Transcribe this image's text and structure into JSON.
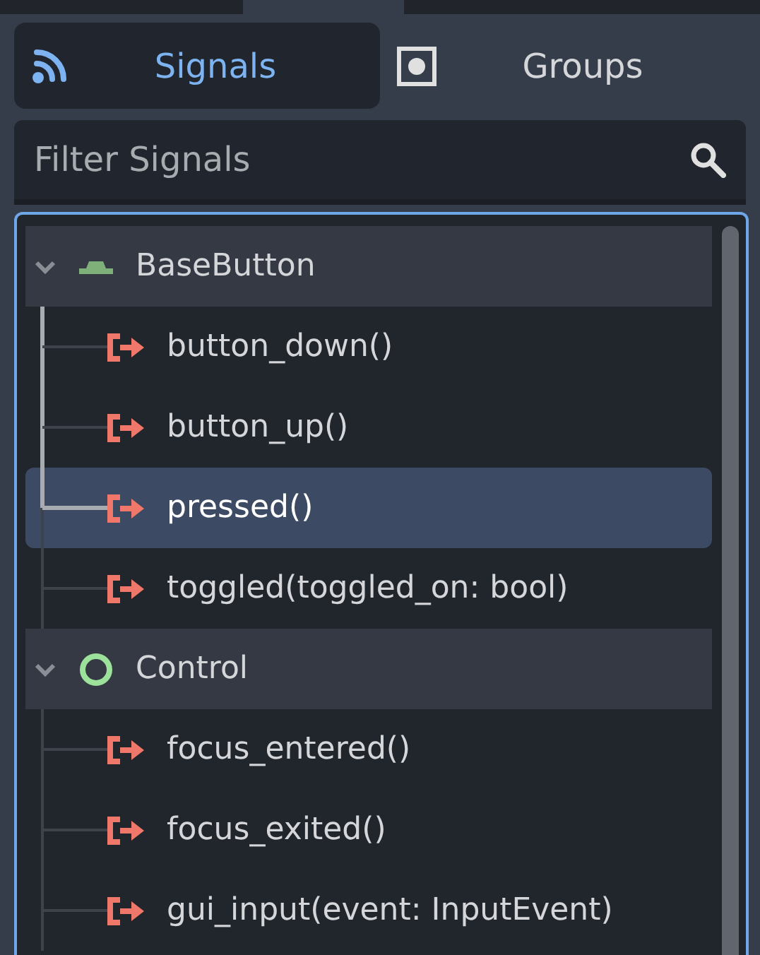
{
  "tabs": [
    {
      "label": "Signals",
      "kind": "signals",
      "selected": true
    },
    {
      "label": "Groups",
      "kind": "groups",
      "selected": false
    }
  ],
  "filter": {
    "placeholder": "Filter Signals"
  },
  "tree": [
    {
      "label": "BaseButton",
      "kind": "button",
      "expanded": true,
      "children": [
        {
          "label": "button_down()",
          "selected": false
        },
        {
          "label": "button_up()",
          "selected": false
        },
        {
          "label": "pressed()",
          "selected": true
        },
        {
          "label": "toggled(toggled_on: bool)",
          "selected": false
        }
      ]
    },
    {
      "label": "Control",
      "kind": "control",
      "expanded": true,
      "children": [
        {
          "label": "focus_entered()",
          "selected": false
        },
        {
          "label": "focus_exited()",
          "selected": false
        },
        {
          "label": "gui_input(event: InputEvent)",
          "selected": false
        }
      ]
    }
  ]
}
